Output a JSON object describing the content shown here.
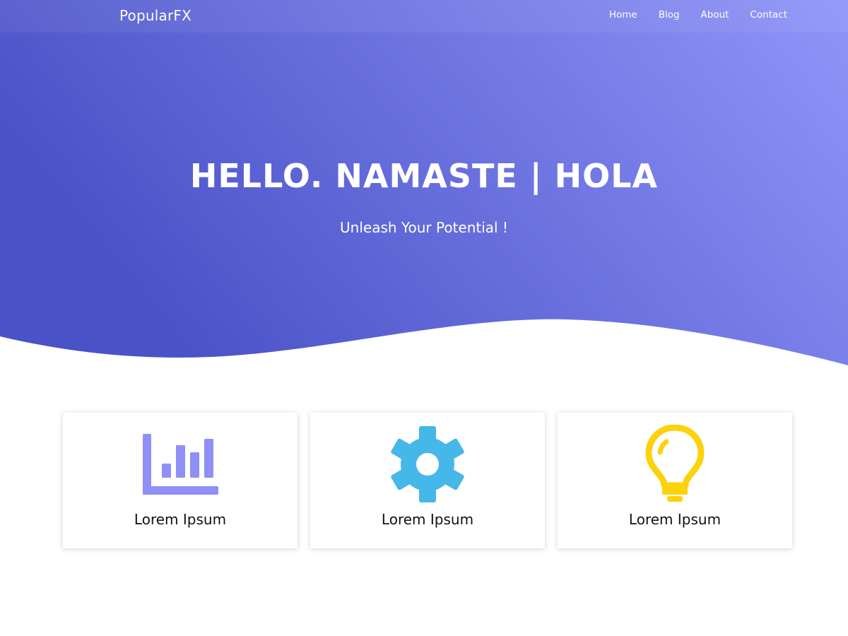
{
  "header": {
    "logo": "PopularFX",
    "nav": [
      "Home",
      "Blog",
      "About",
      "Contact"
    ]
  },
  "hero": {
    "title": "HELLO. NAMASTE | HOLA",
    "subtitle": "Unleash Your Potential !",
    "gradient_start": "#4a52c8",
    "gradient_end": "#8f95f8"
  },
  "features": [
    {
      "icon": "bar-chart-icon",
      "label": "Lorem Ipsum",
      "color": "#8f8ff7"
    },
    {
      "icon": "gear-icon",
      "label": "Lorem Ipsum",
      "color": "#46b7e9"
    },
    {
      "icon": "lightbulb-icon",
      "label": "Lorem Ipsum",
      "color": "#fcd20d"
    }
  ]
}
